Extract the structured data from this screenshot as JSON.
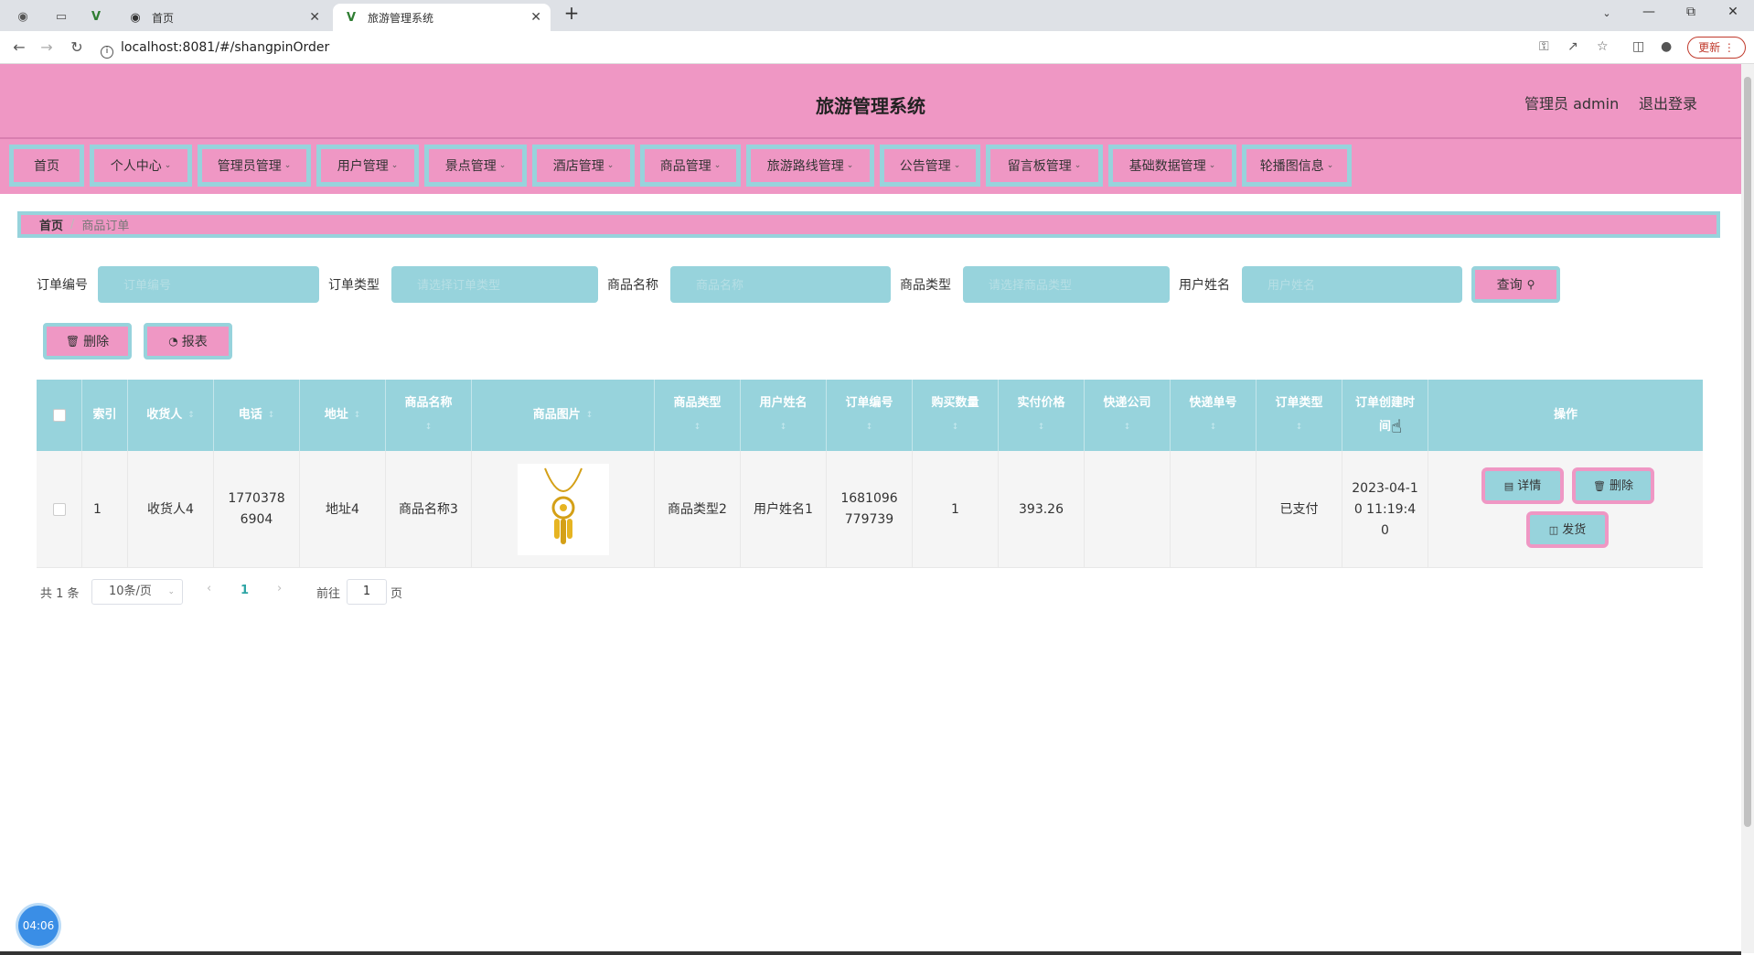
{
  "browser": {
    "tabs": [
      {
        "title": "首页"
      },
      {
        "title": "旅游管理系统"
      }
    ],
    "url": "localhost:8081/#/shangpinOrder",
    "update_label": "更新"
  },
  "header": {
    "title": "旅游管理系统",
    "user": "管理员 admin",
    "logout": "退出登录"
  },
  "nav": [
    {
      "label": "首页"
    },
    {
      "label": "个人中心"
    },
    {
      "label": "管理员管理"
    },
    {
      "label": "用户管理"
    },
    {
      "label": "景点管理"
    },
    {
      "label": "酒店管理"
    },
    {
      "label": "商品管理"
    },
    {
      "label": "旅游路线管理"
    },
    {
      "label": "公告管理"
    },
    {
      "label": "留言板管理"
    },
    {
      "label": "基础数据管理"
    },
    {
      "label": "轮播图信息"
    }
  ],
  "breadcrumb": {
    "home": "首页",
    "current": "商品订单"
  },
  "search": {
    "order_no_label": "订单编号",
    "order_no_placeholder": "订单编号",
    "order_type_label": "订单类型",
    "order_type_placeholder": "请选择订单类型",
    "product_name_label": "商品名称",
    "product_name_placeholder": "商品名称",
    "product_type_label": "商品类型",
    "product_type_placeholder": "请选择商品类型",
    "user_name_label": "用户姓名",
    "user_name_placeholder": "用户姓名",
    "query_label": "查询"
  },
  "actions": {
    "delete_label": "删除",
    "report_label": "报表"
  },
  "table": {
    "headers": {
      "index": "索引",
      "receiver": "收货人",
      "phone": "电话",
      "address": "地址",
      "product_name": "商品名称",
      "product_image": "商品图片",
      "product_type": "商品类型",
      "user_name": "用户姓名",
      "order_no": "订单编号",
      "quantity": "购买数量",
      "price": "实付价格",
      "express_company": "快递公司",
      "express_no": "快递单号",
      "order_type": "订单类型",
      "created_time": "订单创建时间",
      "ops": "操作"
    },
    "rows": [
      {
        "index": "1",
        "receiver": "收货人4",
        "phone": "17703786904",
        "address": "地址4",
        "product_name": "商品名称3",
        "product_type": "商品类型2",
        "user_name": "用户姓名1",
        "order_no": "1681096779739",
        "quantity": "1",
        "price": "393.26",
        "express_company": "",
        "express_no": "",
        "order_type": "已支付",
        "created_time": "2023-04-10 11:19:40"
      }
    ],
    "row_ops": {
      "detail": "详情",
      "delete": "删除",
      "ship": "发货"
    }
  },
  "pagination": {
    "total": "共 1 条",
    "page_size": "10条/页",
    "current_page": "1",
    "goto_prefix": "前往",
    "goto_value": "1",
    "goto_suffix": "页"
  },
  "clock": "04:06",
  "colors": {
    "pink": "#ef97c4",
    "teal": "#97d3dc"
  }
}
